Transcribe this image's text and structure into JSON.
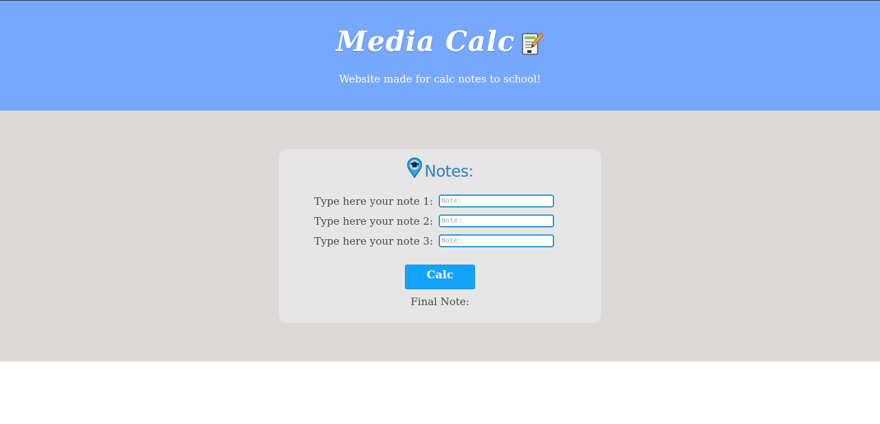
{
  "header": {
    "title": "Media Calc",
    "title_icon": "memo-icon",
    "tagline": "Website made for calc notes to school!",
    "background": "#78a8fc"
  },
  "main": {
    "background": "#dbd8d7"
  },
  "card": {
    "title": "Notes:",
    "title_icon": "graduation-cap-pin-icon",
    "fields": [
      {
        "label": "Type here your note 1:",
        "placeholder": "Note:",
        "value": ""
      },
      {
        "label": "Type here your note 2:",
        "placeholder": "Note:",
        "value": ""
      },
      {
        "label": "Type here your note 3:",
        "placeholder": "Note:",
        "value": ""
      }
    ],
    "calc_button_label": "Calc",
    "final_note_label": "Final Note:",
    "accent_color": "#14a3fa",
    "title_color": "#2a7ec0"
  }
}
